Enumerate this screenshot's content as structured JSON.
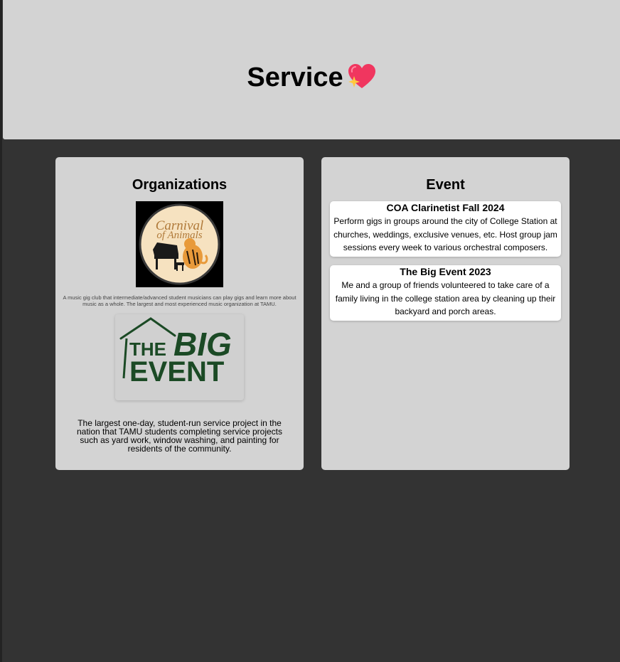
{
  "header": {
    "title": "Service",
    "title_icon": "sparkling-heart-icon"
  },
  "organizations": {
    "title": "Organizations",
    "items": [
      {
        "logo": {
          "name": "carnival-of-animals-logo",
          "text_line1": "Carnival",
          "text_line2": "of Animals"
        },
        "description": "A music gig club that intermediate/advanced student musicians can play gigs and learn more about music as a whole. The largest and most experienced music organization at TAMU."
      },
      {
        "logo": {
          "name": "the-big-event-logo",
          "text_the": "THE",
          "text_big": "BIG",
          "text_event": "EVENT"
        },
        "description": "The largest one-day, student-run service project in the nation that TAMU students completing service projects such as yard work, window washing, and painting for residents of the community."
      }
    ]
  },
  "events": {
    "title": "Event",
    "items": [
      {
        "title": "COA Clarinetist Fall 2024",
        "description": "Perform gigs in groups around the city of College Station at churches, weddings, exclusive venues, etc. Host group jam sessions every week to various orchestral composers."
      },
      {
        "title": "The Big Event 2023",
        "description": "Me and a group of friends volunteered to take care of a family living in the college station area by cleaning up their backyard and porch areas."
      }
    ]
  },
  "colors": {
    "background": "#333333",
    "panel": "#d3d3d3",
    "card": "#ffffff",
    "big_event_green": "#1b4a25",
    "heart": "#f0365f",
    "sparkle": "#ffc83d"
  }
}
